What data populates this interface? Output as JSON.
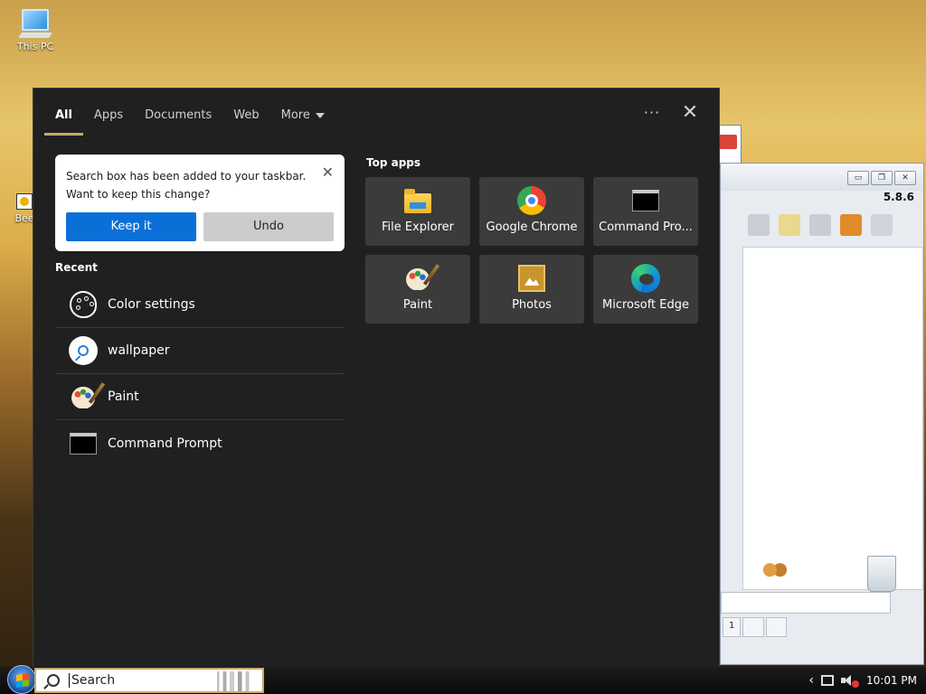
{
  "desktop": {
    "icons": [
      {
        "label": "This PC"
      },
      {
        "label": "Bee"
      }
    ]
  },
  "background_window": {
    "version": "5.8.6",
    "tabs": [
      "1",
      "",
      ""
    ]
  },
  "search_panel": {
    "tabs": [
      {
        "label": "All",
        "active": true
      },
      {
        "label": "Apps",
        "active": false
      },
      {
        "label": "Documents",
        "active": false
      },
      {
        "label": "Web",
        "active": false
      },
      {
        "label": "More",
        "active": false
      }
    ],
    "more_options_label": "···",
    "close_label": "✕",
    "notice": {
      "line1": "Search box has been added to your taskbar.",
      "line2": "Want to keep this change?",
      "keep_label": "Keep it",
      "undo_label": "Undo",
      "close_label": "✕"
    },
    "recent": {
      "title": "Recent",
      "items": [
        {
          "label": "Color settings",
          "icon": "palette-icon"
        },
        {
          "label": "wallpaper",
          "icon": "search-icon"
        },
        {
          "label": "Paint",
          "icon": "paint-icon"
        },
        {
          "label": "Command Prompt",
          "icon": "command-prompt-icon"
        }
      ]
    },
    "top_apps": {
      "title": "Top apps",
      "items": [
        {
          "label": "File Explorer",
          "icon": "file-explorer-icon"
        },
        {
          "label": "Google Chrome",
          "icon": "chrome-icon"
        },
        {
          "label": "Command Pro...",
          "icon": "command-prompt-icon"
        },
        {
          "label": "Paint",
          "icon": "paint-icon"
        },
        {
          "label": "Photos",
          "icon": "photos-icon"
        },
        {
          "label": "Microsoft Edge",
          "icon": "edge-icon"
        }
      ]
    }
  },
  "taskbar": {
    "search_value": "Search",
    "tray_chevron": "‹",
    "clock": "10:01 PM"
  },
  "colors": {
    "accent": "#c9a86a",
    "keep_button": "#0b6fd8",
    "panel_bg": "#202020",
    "tile_bg": "#3b3b3b"
  }
}
